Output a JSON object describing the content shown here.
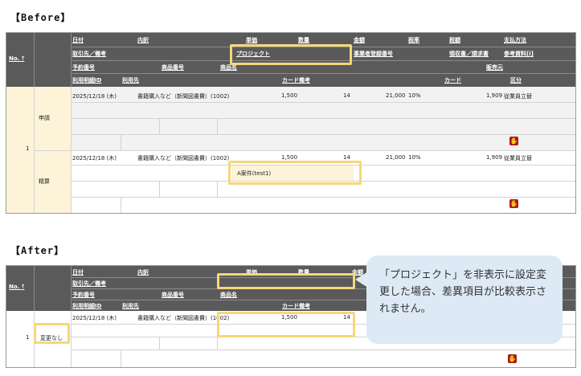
{
  "before": {
    "label": "【Before】",
    "header": {
      "no": "No.",
      "row1": [
        "日付",
        "内訳",
        "単価",
        "数量",
        "金額",
        "税率",
        "税額",
        "支払方法"
      ],
      "row2": [
        "取引先／備考",
        "プロジェクト",
        "事業者登録番号",
        "領収書／請求書",
        "参考資料[i]"
      ],
      "row3": [
        "予約番号",
        "商品番号",
        "商品名",
        "販売元"
      ],
      "row4": [
        "利用明細ID",
        "利用先",
        "カード備考",
        "カード",
        "区分"
      ]
    },
    "row_number": "1",
    "apply": {
      "label": "申請",
      "date": "2025/12/18 (木)",
      "item": "書籍購入など（新聞図書費）(1002)",
      "price": "1,500",
      "qty": "14",
      "amount": "21,000",
      "tax_rate": "10%",
      "tax": "1,909",
      "payment": "従業員立替"
    },
    "settle": {
      "label": "精算",
      "date": "2025/12/18 (木)",
      "item": "書籍購入など（新聞図書費）(1002)",
      "price": "1,500",
      "qty": "14",
      "amount": "21,000",
      "tax_rate": "10%",
      "tax": "1,909",
      "payment": "従業員立替",
      "project": "A案件(test1)"
    }
  },
  "after": {
    "label": "【After】",
    "header": {
      "no": "No.",
      "row1": [
        "日付",
        "内訳",
        "単価",
        "数量",
        "金額"
      ],
      "row2": [
        "取引先／備考"
      ],
      "row3": [
        "予約番号",
        "商品番号",
        "商品名"
      ],
      "row4": [
        "利用明細ID",
        "利用先",
        "カード備考"
      ]
    },
    "row_number": "1",
    "status": "変更なし",
    "date": "2025/12/18 (木)",
    "item": "書籍購入など（新聞図書費）(1002)",
    "price": "1,500",
    "qty": "14"
  },
  "bubble_text": "「プロジェクト」を非表示に設定変更した場合、差異項目が比較表示されません。",
  "colors": {
    "header_bg": "#5a5a5a",
    "highlight": "#f5d77a",
    "project_bg": "#fdf3d8",
    "bubble_bg": "#dde9f5",
    "hand_icon": "#b01818"
  }
}
